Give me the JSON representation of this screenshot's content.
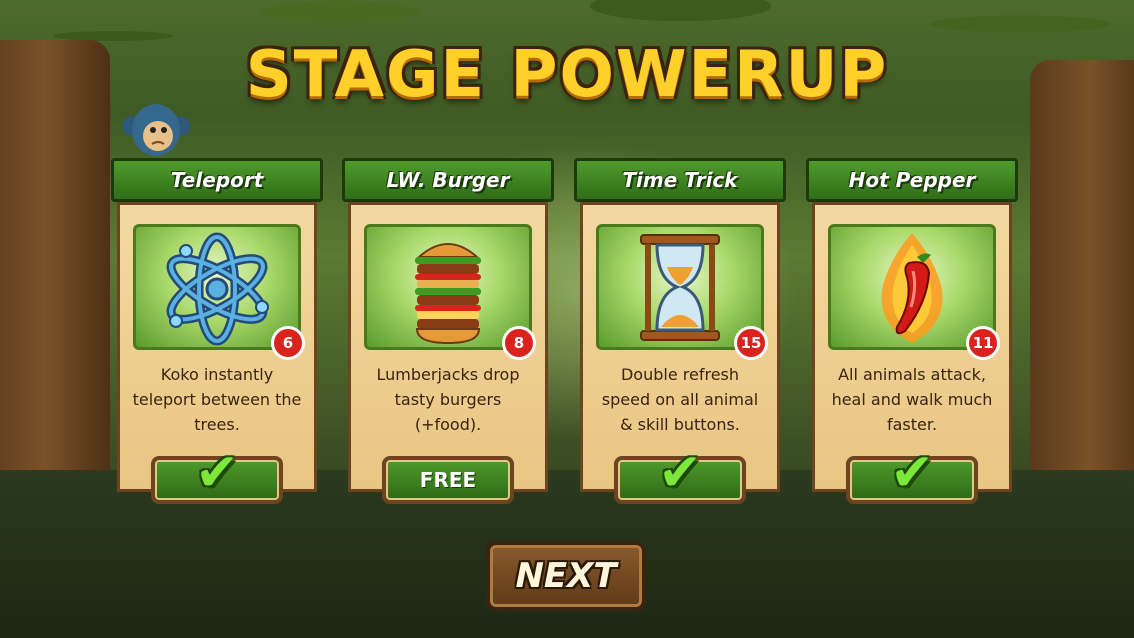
{
  "screen": {
    "title": "STAGE POWERUP"
  },
  "cards": [
    {
      "name": "Teleport",
      "icon": "atom-icon",
      "count": "6",
      "description": "Koko instantly\nteleport between the\ntrees.",
      "button": {
        "state": "selected",
        "icon": "checkmark-icon"
      }
    },
    {
      "name": "LW. Burger",
      "icon": "burger-icon",
      "count": "8",
      "description": "Lumberjacks drop\ntasty burgers\n(+food).",
      "button": {
        "state": "free",
        "label": "FREE"
      }
    },
    {
      "name": "Time Trick",
      "icon": "hourglass-icon",
      "count": "15",
      "description": "Double refresh\nspeed on all animal\n& skill buttons.",
      "button": {
        "state": "selected",
        "icon": "checkmark-icon"
      }
    },
    {
      "name": "Hot Pepper",
      "icon": "chili-pepper-icon",
      "count": "11",
      "description": "All animals attack,\nheal and walk much\nfaster.",
      "button": {
        "state": "selected",
        "icon": "checkmark-icon"
      }
    }
  ],
  "next_button": {
    "label": "NEXT"
  },
  "colors": {
    "title": "#ffd02a",
    "header_green": "#3f8422",
    "badge_red": "#d9231c",
    "check_green": "#7ee83a"
  }
}
